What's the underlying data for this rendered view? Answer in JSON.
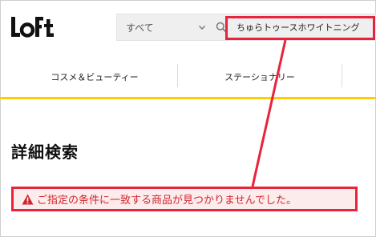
{
  "header": {
    "logo_text": "LoFt",
    "category_select": {
      "selected": "すべて"
    },
    "search": {
      "value": "ちゅらトゥースホワイトニング"
    }
  },
  "nav": {
    "items": [
      {
        "label": "コスメ＆ビューティー"
      },
      {
        "label": "ステーショナリー"
      }
    ]
  },
  "page": {
    "title": "詳細検索",
    "alert": {
      "message": "ご指定の条件に一致する商品が見つかりませんでした。"
    }
  },
  "colors": {
    "accent_yellow": "#ffcc00",
    "alert_red": "#d0262f",
    "annotation_red": "#e8233b",
    "alert_background": "#fdecec"
  }
}
